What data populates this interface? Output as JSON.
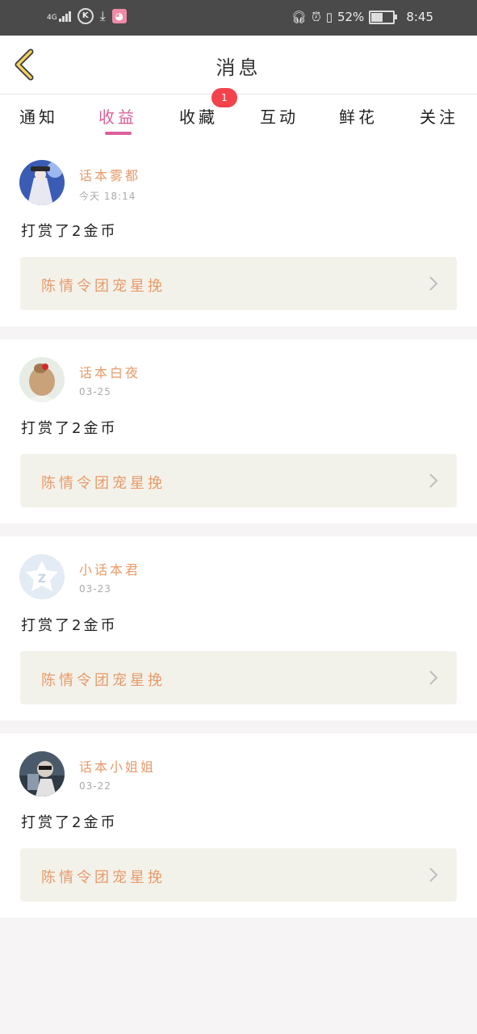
{
  "status": {
    "net": "4G",
    "battery_pct": "52%",
    "battery_level": 0.52,
    "time": "8:45"
  },
  "header": {
    "title": "消息"
  },
  "tabs": [
    {
      "label": "通知"
    },
    {
      "label": "收益"
    },
    {
      "label": "收藏"
    },
    {
      "label": "互动"
    },
    {
      "label": "鲜花"
    },
    {
      "label": "关注"
    }
  ],
  "active_tab": "收益",
  "badge": {
    "count": "1"
  },
  "messages": [
    {
      "user": "话本雾都",
      "time": "今天 18:14",
      "text": "打赏了2金币",
      "ref": "陈情令团宠星挽"
    },
    {
      "user": "话本白夜",
      "time": "03-25",
      "text": "打赏了2金币",
      "ref": "陈情令团宠星挽"
    },
    {
      "user": "小话本君",
      "time": "03-23",
      "text": "打赏了2金币",
      "ref": "陈情令团宠星挽"
    },
    {
      "user": "话本小姐姐",
      "time": "03-22",
      "text": "打赏了2金币",
      "ref": "陈情令团宠星挽"
    }
  ],
  "colors": {
    "accent": "#d9609a",
    "name": "#e89a6a",
    "badge": "#f2434d"
  }
}
